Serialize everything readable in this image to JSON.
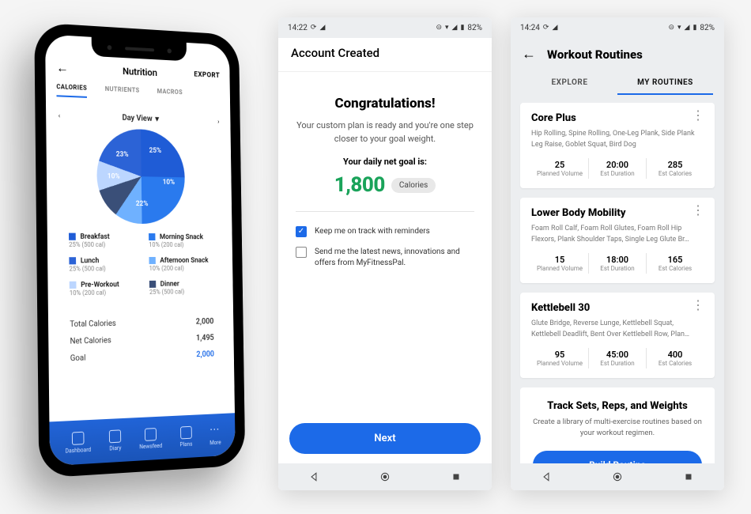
{
  "chart_data": {
    "type": "pie",
    "title": "Nutrition – Calories (Day View)",
    "series": [
      {
        "name": "Breakfast",
        "value": 25,
        "pct_label": "25%",
        "detail": "25% (500 cal)",
        "color": "#1f5cd6"
      },
      {
        "name": "Morning Snack",
        "value": 10,
        "pct_label": "10%",
        "detail": "10% (200 cal)",
        "color": "#2a7aee"
      },
      {
        "name": "Lunch",
        "value": 25,
        "pct_label": "25%",
        "detail": "25% (500 cal)",
        "color": "#2c63d6"
      },
      {
        "name": "Afternoon Snack",
        "value": 10,
        "pct_label": "10%",
        "detail": "10% (200 cal)",
        "color": "#6fb1ff"
      },
      {
        "name": "Pre-Workout",
        "value": 10,
        "pct_label": "10%",
        "detail": "10% (200 cal)",
        "color": "#bcd6ff"
      },
      {
        "name": "Dinner",
        "value": 25,
        "pct_label": "25%",
        "detail": "25% (500 cal)",
        "color": "#3a4f78"
      }
    ],
    "visible_slice_labels": [
      "25%",
      "23%",
      "10%",
      "22%",
      "10%"
    ]
  },
  "phone1": {
    "title": "Nutrition",
    "export": "EXPORT",
    "tabs": {
      "calories": "CALORIES",
      "nutrients": "NUTRIENTS",
      "macros": "MACROS"
    },
    "dayview": "Day View",
    "nav_prev": "‹",
    "nav_next": "›",
    "legend": [
      {
        "sw": "#1f5cd6",
        "title": "Breakfast",
        "sub": "25% (500 cal)"
      },
      {
        "sw": "#2a7aee",
        "title": "Morning Snack",
        "sub": "10% (200 cal)"
      },
      {
        "sw": "#2c63d6",
        "title": "Lunch",
        "sub": "25% (500 cal)"
      },
      {
        "sw": "#6fb1ff",
        "title": "Afternoon Snack",
        "sub": "10% (200 cal)"
      },
      {
        "sw": "#bcd6ff",
        "title": "Pre-Workout",
        "sub": "10% (200 cal)"
      },
      {
        "sw": "#3a4f78",
        "title": "Dinner",
        "sub": "25% (500 cal)"
      }
    ],
    "totals": {
      "total_l": "Total Calories",
      "total_v": "2,000",
      "net_l": "Net Calories",
      "net_v": "1,495",
      "goal_l": "Goal",
      "goal_v": "2,000"
    },
    "bottom": [
      "Dashboard",
      "Diary",
      "Newsfeed",
      "Plans",
      "More"
    ]
  },
  "status": {
    "t1": "14:22",
    "t2": "14:24",
    "batt": "82%"
  },
  "phone2": {
    "header": "Account Created",
    "cong": "Congratulations!",
    "sub": "Your custom plan is ready and you're one step closer to your goal weight.",
    "goal_l": "Your daily net goal is:",
    "goal_v": "1,800",
    "goal_u": "Calories",
    "chk1": "Keep me on track with reminders",
    "chk2": "Send me the latest news, innovations and offers from MyFitnessPal.",
    "next": "Next"
  },
  "phone3": {
    "title": "Workout Routines",
    "tabs": {
      "explore": "EXPLORE",
      "mine": "MY ROUTINES"
    },
    "routines": [
      {
        "title": "Core Plus",
        "desc": "Hip Rolling, Spine Rolling, One-Leg Plank, Side Plank Leg Raise, Goblet Squat, Bird Dog",
        "vol": "25",
        "dur": "20:00",
        "cal": "285"
      },
      {
        "title": "Lower Body Mobility",
        "desc": "Foam Roll Calf, Foam Roll Glutes, Foam Roll Hip Flexors, Plank Shoulder Taps, Single Leg Glute Br…",
        "vol": "15",
        "dur": "18:00",
        "cal": "165"
      },
      {
        "title": "Kettlebell 30",
        "desc": "Glute Bridge, Reverse Lunge, Kettlebell Squat, Kettlebell Deadlift, Bent Over Kettlebell Row, Plan…",
        "vol": "95",
        "dur": "45:00",
        "cal": "400"
      }
    ],
    "stat_labels": {
      "vol": "Planned Volume",
      "dur": "Est Duration",
      "cal": "Est Calories"
    },
    "promo": {
      "t": "Track Sets, Reps, and Weights",
      "s": "Create a library of multi-exercise routines based on your workout regimen.",
      "b": "Build Routine"
    }
  }
}
